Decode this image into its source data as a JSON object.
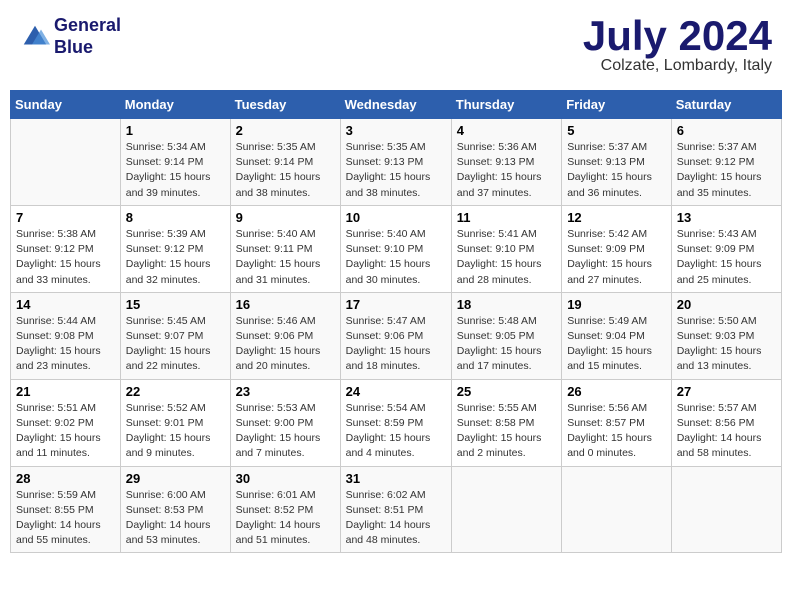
{
  "header": {
    "logo_line1": "General",
    "logo_line2": "Blue",
    "month": "July 2024",
    "location": "Colzate, Lombardy, Italy"
  },
  "columns": [
    "Sunday",
    "Monday",
    "Tuesday",
    "Wednesday",
    "Thursday",
    "Friday",
    "Saturday"
  ],
  "weeks": [
    [
      {
        "day": "",
        "info": ""
      },
      {
        "day": "1",
        "info": "Sunrise: 5:34 AM\nSunset: 9:14 PM\nDaylight: 15 hours\nand 39 minutes."
      },
      {
        "day": "2",
        "info": "Sunrise: 5:35 AM\nSunset: 9:14 PM\nDaylight: 15 hours\nand 38 minutes."
      },
      {
        "day": "3",
        "info": "Sunrise: 5:35 AM\nSunset: 9:13 PM\nDaylight: 15 hours\nand 38 minutes."
      },
      {
        "day": "4",
        "info": "Sunrise: 5:36 AM\nSunset: 9:13 PM\nDaylight: 15 hours\nand 37 minutes."
      },
      {
        "day": "5",
        "info": "Sunrise: 5:37 AM\nSunset: 9:13 PM\nDaylight: 15 hours\nand 36 minutes."
      },
      {
        "day": "6",
        "info": "Sunrise: 5:37 AM\nSunset: 9:12 PM\nDaylight: 15 hours\nand 35 minutes."
      }
    ],
    [
      {
        "day": "7",
        "info": "Sunrise: 5:38 AM\nSunset: 9:12 PM\nDaylight: 15 hours\nand 33 minutes."
      },
      {
        "day": "8",
        "info": "Sunrise: 5:39 AM\nSunset: 9:12 PM\nDaylight: 15 hours\nand 32 minutes."
      },
      {
        "day": "9",
        "info": "Sunrise: 5:40 AM\nSunset: 9:11 PM\nDaylight: 15 hours\nand 31 minutes."
      },
      {
        "day": "10",
        "info": "Sunrise: 5:40 AM\nSunset: 9:10 PM\nDaylight: 15 hours\nand 30 minutes."
      },
      {
        "day": "11",
        "info": "Sunrise: 5:41 AM\nSunset: 9:10 PM\nDaylight: 15 hours\nand 28 minutes."
      },
      {
        "day": "12",
        "info": "Sunrise: 5:42 AM\nSunset: 9:09 PM\nDaylight: 15 hours\nand 27 minutes."
      },
      {
        "day": "13",
        "info": "Sunrise: 5:43 AM\nSunset: 9:09 PM\nDaylight: 15 hours\nand 25 minutes."
      }
    ],
    [
      {
        "day": "14",
        "info": "Sunrise: 5:44 AM\nSunset: 9:08 PM\nDaylight: 15 hours\nand 23 minutes."
      },
      {
        "day": "15",
        "info": "Sunrise: 5:45 AM\nSunset: 9:07 PM\nDaylight: 15 hours\nand 22 minutes."
      },
      {
        "day": "16",
        "info": "Sunrise: 5:46 AM\nSunset: 9:06 PM\nDaylight: 15 hours\nand 20 minutes."
      },
      {
        "day": "17",
        "info": "Sunrise: 5:47 AM\nSunset: 9:06 PM\nDaylight: 15 hours\nand 18 minutes."
      },
      {
        "day": "18",
        "info": "Sunrise: 5:48 AM\nSunset: 9:05 PM\nDaylight: 15 hours\nand 17 minutes."
      },
      {
        "day": "19",
        "info": "Sunrise: 5:49 AM\nSunset: 9:04 PM\nDaylight: 15 hours\nand 15 minutes."
      },
      {
        "day": "20",
        "info": "Sunrise: 5:50 AM\nSunset: 9:03 PM\nDaylight: 15 hours\nand 13 minutes."
      }
    ],
    [
      {
        "day": "21",
        "info": "Sunrise: 5:51 AM\nSunset: 9:02 PM\nDaylight: 15 hours\nand 11 minutes."
      },
      {
        "day": "22",
        "info": "Sunrise: 5:52 AM\nSunset: 9:01 PM\nDaylight: 15 hours\nand 9 minutes."
      },
      {
        "day": "23",
        "info": "Sunrise: 5:53 AM\nSunset: 9:00 PM\nDaylight: 15 hours\nand 7 minutes."
      },
      {
        "day": "24",
        "info": "Sunrise: 5:54 AM\nSunset: 8:59 PM\nDaylight: 15 hours\nand 4 minutes."
      },
      {
        "day": "25",
        "info": "Sunrise: 5:55 AM\nSunset: 8:58 PM\nDaylight: 15 hours\nand 2 minutes."
      },
      {
        "day": "26",
        "info": "Sunrise: 5:56 AM\nSunset: 8:57 PM\nDaylight: 15 hours\nand 0 minutes."
      },
      {
        "day": "27",
        "info": "Sunrise: 5:57 AM\nSunset: 8:56 PM\nDaylight: 14 hours\nand 58 minutes."
      }
    ],
    [
      {
        "day": "28",
        "info": "Sunrise: 5:59 AM\nSunset: 8:55 PM\nDaylight: 14 hours\nand 55 minutes."
      },
      {
        "day": "29",
        "info": "Sunrise: 6:00 AM\nSunset: 8:53 PM\nDaylight: 14 hours\nand 53 minutes."
      },
      {
        "day": "30",
        "info": "Sunrise: 6:01 AM\nSunset: 8:52 PM\nDaylight: 14 hours\nand 51 minutes."
      },
      {
        "day": "31",
        "info": "Sunrise: 6:02 AM\nSunset: 8:51 PM\nDaylight: 14 hours\nand 48 minutes."
      },
      {
        "day": "",
        "info": ""
      },
      {
        "day": "",
        "info": ""
      },
      {
        "day": "",
        "info": ""
      }
    ]
  ]
}
